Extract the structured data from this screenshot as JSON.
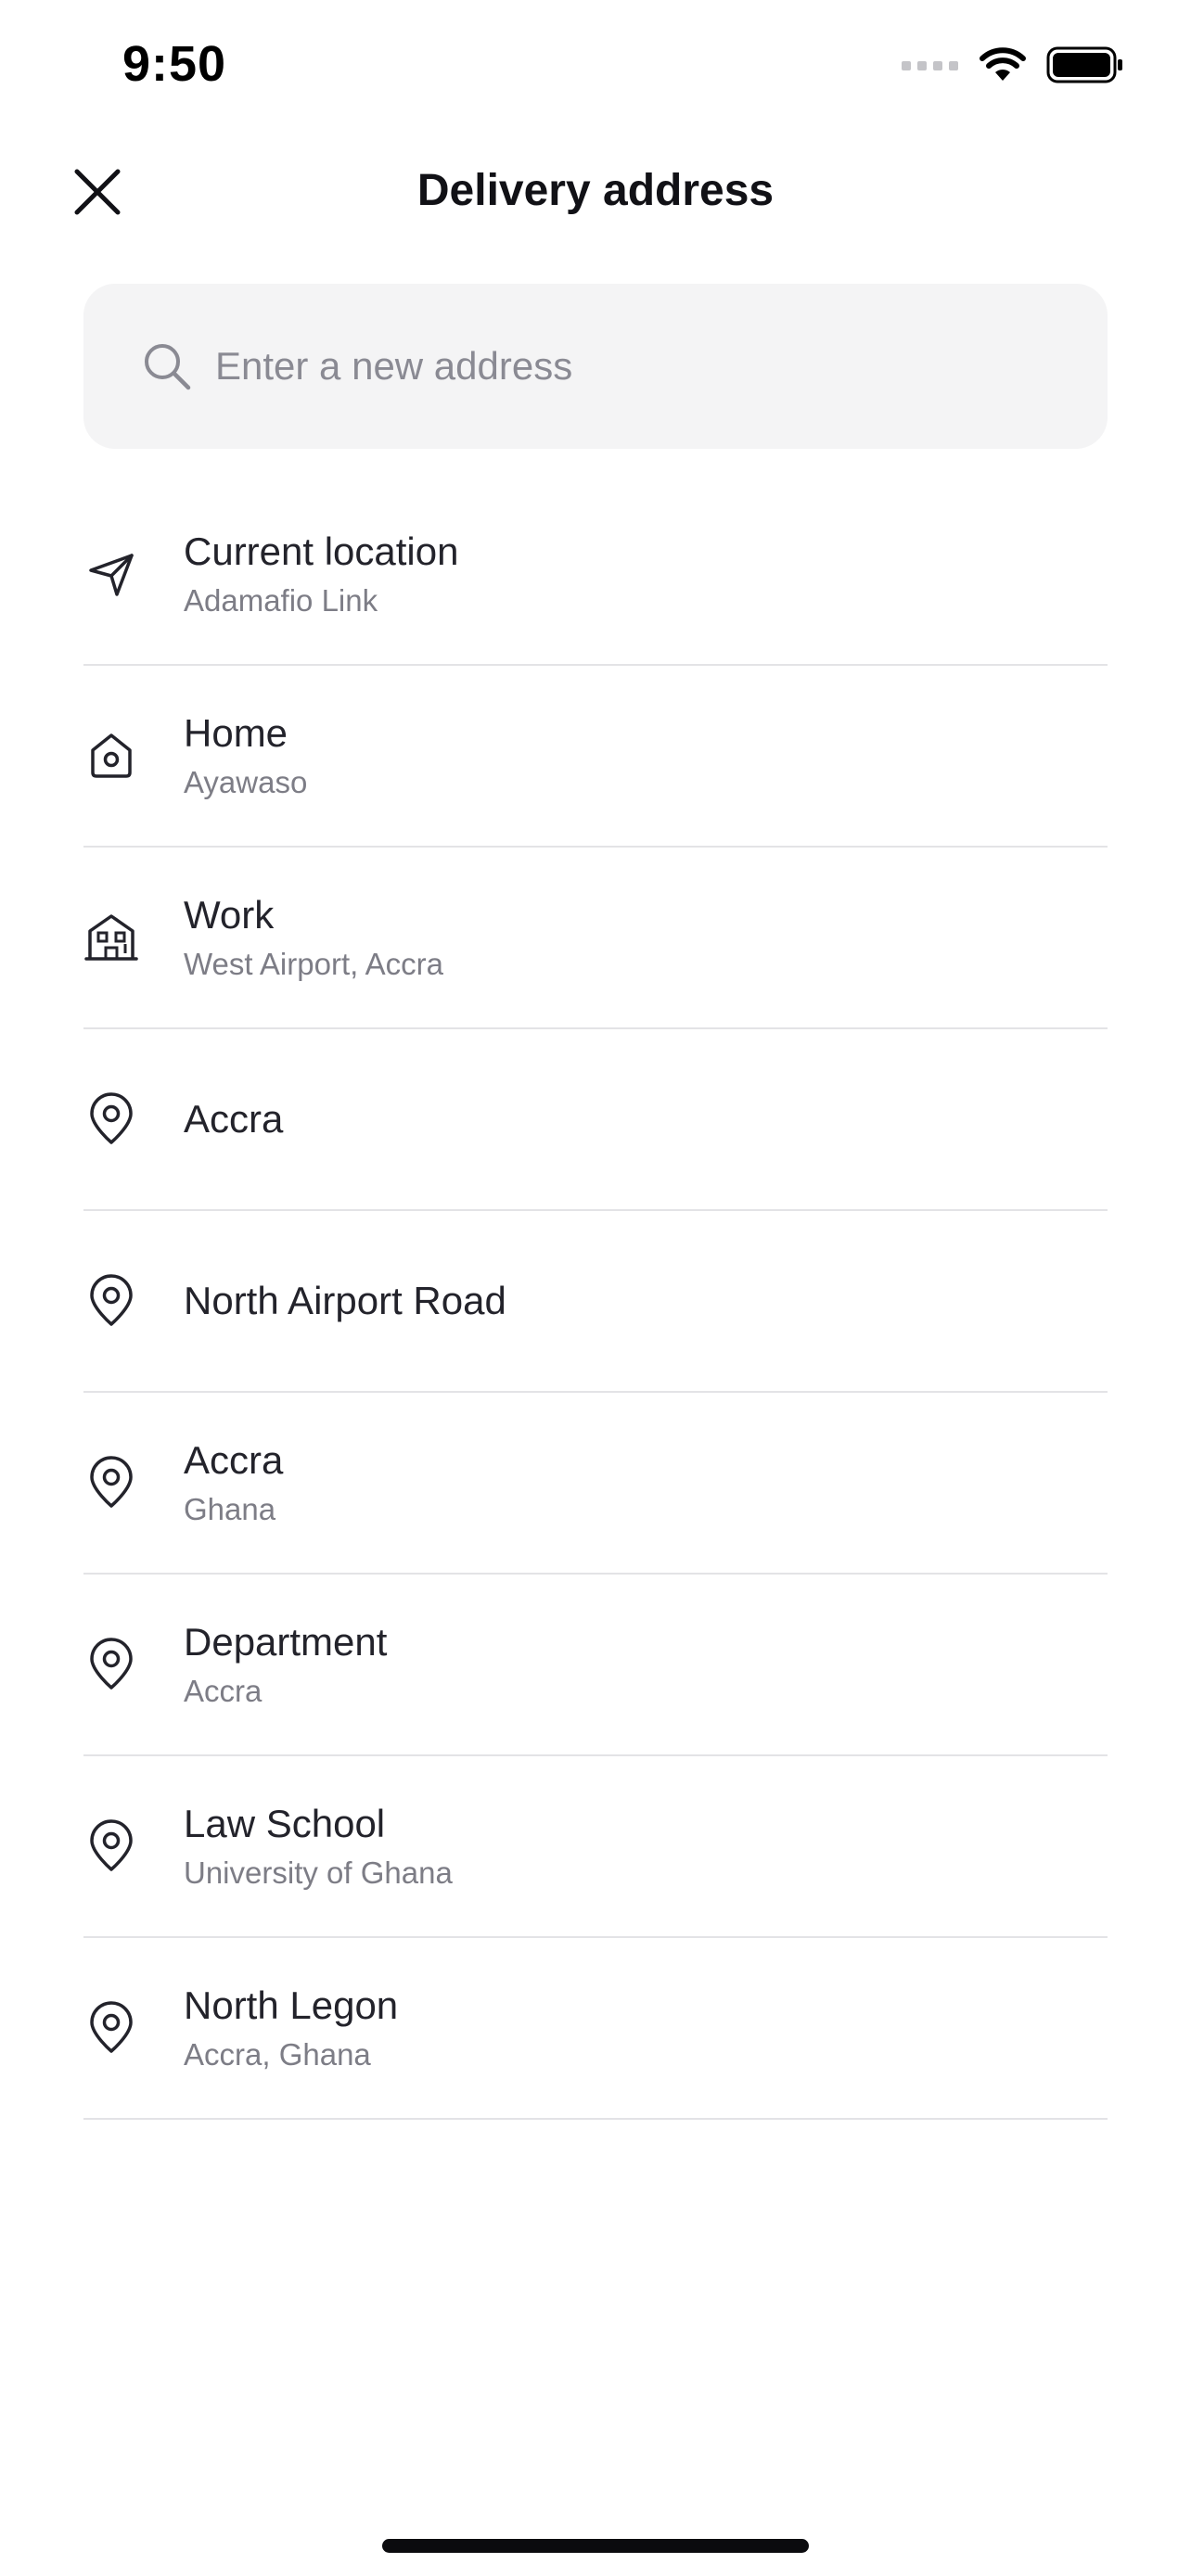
{
  "status_bar": {
    "time": "9:50",
    "icons": [
      "signal-icon",
      "wifi-icon",
      "battery-icon"
    ]
  },
  "header": {
    "title": "Delivery address",
    "close_icon": "close-icon"
  },
  "search": {
    "placeholder": "Enter a new address",
    "value": "",
    "icon": "search-icon"
  },
  "addresses": [
    {
      "icon": "navigation-arrow-icon",
      "title": "Current location",
      "subtitle": "Adamafio Link"
    },
    {
      "icon": "home-icon",
      "title": "Home",
      "subtitle": "Ayawaso"
    },
    {
      "icon": "building-icon",
      "title": "Work",
      "subtitle": "West Airport, Accra"
    },
    {
      "icon": "map-pin-icon",
      "title": "Accra",
      "subtitle": ""
    },
    {
      "icon": "map-pin-icon",
      "title": "North Airport Road",
      "subtitle": ""
    },
    {
      "icon": "map-pin-icon",
      "title": "Accra",
      "subtitle": "Ghana"
    },
    {
      "icon": "map-pin-icon",
      "title": "Department",
      "subtitle": "Accra"
    },
    {
      "icon": "map-pin-icon",
      "title": "Law School",
      "subtitle": "University of Ghana"
    },
    {
      "icon": "map-pin-icon",
      "title": "North Legon",
      "subtitle": "Accra, Ghana"
    }
  ],
  "colors": {
    "text_primary": "#23232b",
    "text_secondary": "#7d7d86",
    "search_background": "#f4f4f5",
    "divider": "#e3e3e6"
  }
}
